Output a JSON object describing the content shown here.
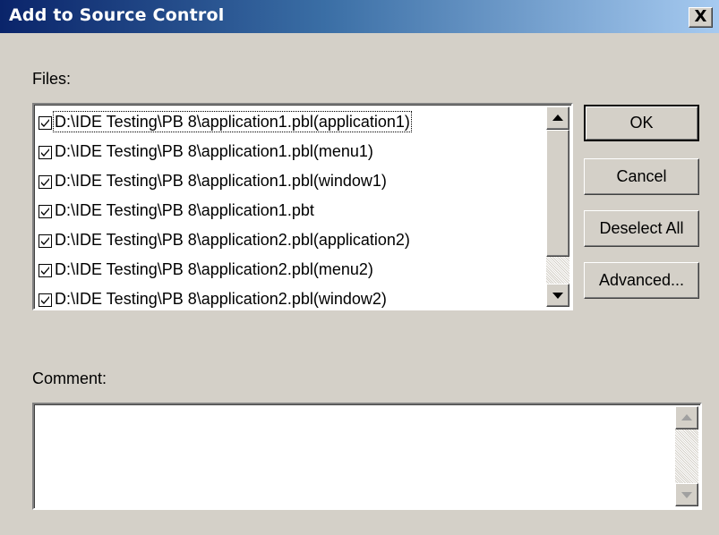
{
  "window": {
    "title": "Add to Source Control",
    "close_label": "X"
  },
  "files": {
    "label": "Files:",
    "items": [
      {
        "checked": true,
        "path": "D:\\IDE Testing\\PB 8\\application1.pbl(application1)"
      },
      {
        "checked": true,
        "path": "D:\\IDE Testing\\PB 8\\application1.pbl(menu1)"
      },
      {
        "checked": true,
        "path": "D:\\IDE Testing\\PB 8\\application1.pbl(window1)"
      },
      {
        "checked": true,
        "path": "D:\\IDE Testing\\PB 8\\application1.pbt"
      },
      {
        "checked": true,
        "path": "D:\\IDE Testing\\PB 8\\application2.pbl(application2)"
      },
      {
        "checked": true,
        "path": "D:\\IDE Testing\\PB 8\\application2.pbl(menu2)"
      },
      {
        "checked": true,
        "path": "D:\\IDE Testing\\PB 8\\application2.pbl(window2)"
      }
    ]
  },
  "buttons": {
    "ok": "OK",
    "cancel": "Cancel",
    "deselect_all": "Deselect All",
    "advanced": "Advanced..."
  },
  "comment": {
    "label": "Comment:",
    "value": ""
  },
  "colors": {
    "face": "#d4d0c8",
    "title_start": "#0a246a",
    "title_end": "#a6caf0"
  },
  "icons": {
    "checkbox": "checkmark-icon",
    "scroll_up": "arrow-up-icon",
    "scroll_down": "arrow-down-icon"
  }
}
